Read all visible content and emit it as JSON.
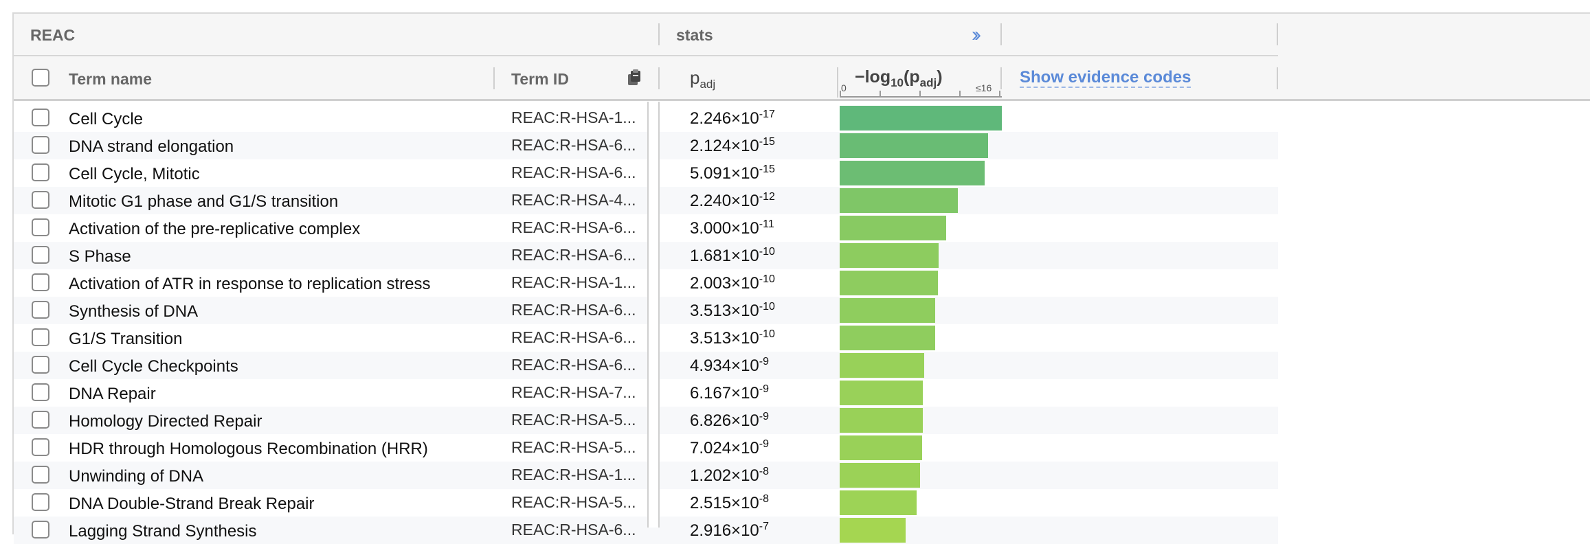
{
  "header": {
    "group_label": "REAC",
    "stats_label": "stats",
    "chevrons": "››",
    "columns": {
      "term_name": "Term name",
      "term_id": "Term ID",
      "padj_main": "p",
      "padj_sub": "adj",
      "log_prefix": "−log",
      "log_base": "10",
      "log_p": "(p",
      "log_adj": "adj",
      "log_close": ")",
      "axis_min": "0",
      "axis_max": "≤16"
    },
    "evidence_link": "Show evidence codes"
  },
  "colors": {
    "link": "#5b8ad8",
    "bar_scale_start": "#5fb87a",
    "bar_scale_end": "#a9d84f"
  },
  "rows": [
    {
      "name": "Cell Cycle",
      "id": "REAC:R-HSA-1...",
      "p_mant": "2.246×10",
      "p_exp": "-17",
      "neglog": 16.65
    },
    {
      "name": "DNA strand elongation",
      "id": "REAC:R-HSA-6...",
      "p_mant": "2.124×10",
      "p_exp": "-15",
      "neglog": 14.67
    },
    {
      "name": "Cell Cycle, Mitotic",
      "id": "REAC:R-HSA-6...",
      "p_mant": "5.091×10",
      "p_exp": "-15",
      "neglog": 14.29
    },
    {
      "name": "Mitotic G1 phase and G1/S transition",
      "id": "REAC:R-HSA-4...",
      "p_mant": "2.240×10",
      "p_exp": "-12",
      "neglog": 11.65
    },
    {
      "name": "Activation of the pre-replicative complex",
      "id": "REAC:R-HSA-6...",
      "p_mant": "3.000×10",
      "p_exp": "-11",
      "neglog": 10.52
    },
    {
      "name": "S Phase",
      "id": "REAC:R-HSA-6...",
      "p_mant": "1.681×10",
      "p_exp": "-10",
      "neglog": 9.77
    },
    {
      "name": "Activation of ATR in response to replication stress",
      "id": "REAC:R-HSA-1...",
      "p_mant": "2.003×10",
      "p_exp": "-10",
      "neglog": 9.7
    },
    {
      "name": "Synthesis of DNA",
      "id": "REAC:R-HSA-6...",
      "p_mant": "3.513×10",
      "p_exp": "-10",
      "neglog": 9.45
    },
    {
      "name": "G1/S Transition",
      "id": "REAC:R-HSA-6...",
      "p_mant": "3.513×10",
      "p_exp": "-10",
      "neglog": 9.45
    },
    {
      "name": "Cell Cycle Checkpoints",
      "id": "REAC:R-HSA-6...",
      "p_mant": "4.934×10",
      "p_exp": "-9",
      "neglog": 8.31
    },
    {
      "name": "DNA Repair",
      "id": "REAC:R-HSA-7...",
      "p_mant": "6.167×10",
      "p_exp": "-9",
      "neglog": 8.21
    },
    {
      "name": "Homology Directed Repair",
      "id": "REAC:R-HSA-5...",
      "p_mant": "6.826×10",
      "p_exp": "-9",
      "neglog": 8.17
    },
    {
      "name": "HDR through Homologous Recombination (HRR)",
      "id": "REAC:R-HSA-5...",
      "p_mant": "7.024×10",
      "p_exp": "-9",
      "neglog": 8.15
    },
    {
      "name": "Unwinding of DNA",
      "id": "REAC:R-HSA-1...",
      "p_mant": "1.202×10",
      "p_exp": "-8",
      "neglog": 7.92
    },
    {
      "name": "DNA Double-Strand Break Repair",
      "id": "REAC:R-HSA-5...",
      "p_mant": "2.515×10",
      "p_exp": "-8",
      "neglog": 7.6
    },
    {
      "name": "Lagging Strand Synthesis",
      "id": "REAC:R-HSA-6...",
      "p_mant": "2.916×10",
      "p_exp": "-7",
      "neglog": 6.54
    }
  ]
}
